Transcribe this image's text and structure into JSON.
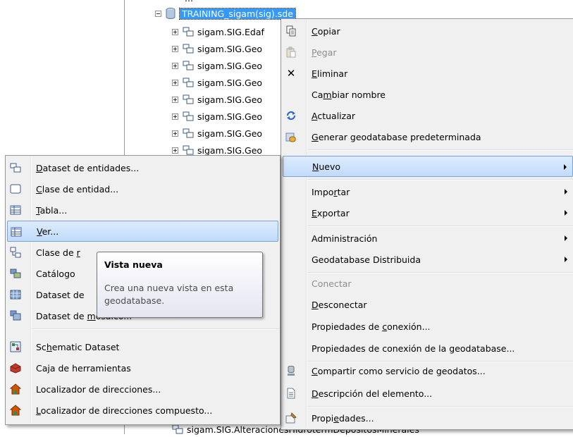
{
  "tree": {
    "top_partial": "...",
    "connection_label": "TRAINING_sigam(sig).sde",
    "items": [
      {
        "label": "sigam.SIG.Edaf"
      },
      {
        "label": "sigam.SIG.Geo"
      },
      {
        "label": "sigam.SIG.Geo"
      },
      {
        "label": "sigam.SIG.Geo"
      },
      {
        "label": "sigam.SIG.Geo"
      },
      {
        "label": "sigam.SIG.Geo"
      },
      {
        "label": "sigam.SIG.Geo"
      },
      {
        "label": "sigam.SIG.Geo"
      }
    ],
    "bottom_item": "sigam.SIG.AlteracionesHidrotermDepositosMinerales"
  },
  "context_menu": {
    "copiar": {
      "pre": "",
      "key": "C",
      "post": "opiar",
      "icon": "copy-icon"
    },
    "pegar": {
      "pre": "",
      "key": "P",
      "post": "egar",
      "icon": "paste-icon"
    },
    "eliminar": {
      "pre": "",
      "key": "E",
      "post": "liminar",
      "icon": "delete-icon"
    },
    "cambiar_nombre": {
      "pre": "Ca",
      "key": "m",
      "post": "biar nombre"
    },
    "actualizar": {
      "pre": "",
      "key": "A",
      "post": "ctualizar",
      "icon": "refresh-icon"
    },
    "generar": {
      "pre": "",
      "key": "G",
      "post": "enerar geodatabase predeterminada",
      "icon": "default-geodatabase-icon"
    },
    "nuevo": {
      "pre": "",
      "key": "N",
      "post": "uevo"
    },
    "importar": {
      "pre": "Impo",
      "key": "r",
      "post": "tar"
    },
    "exportar": {
      "pre": "",
      "key": "E",
      "post": "xportar"
    },
    "administracion": {
      "label": "Administración"
    },
    "geodatabase_distribuida": {
      "label": "Geodatabase Distribuida"
    },
    "conectar": {
      "label": "Conectar"
    },
    "desconectar": {
      "pre": "",
      "key": "D",
      "post": "esconectar"
    },
    "prop_conexion": {
      "pre": "Propiedades de ",
      "key": "c",
      "post": "onexión..."
    },
    "prop_conexion_gdb": {
      "label": "Propiedades de conexión de la geodatabase..."
    },
    "compartir": {
      "pre": "",
      "key": "C",
      "post": "ompartir como servicio de geodatos...",
      "icon": "share-service-icon"
    },
    "descripcion": {
      "pre": "",
      "key": "D",
      "post": "escripción del elemento...",
      "icon": "item-description-icon"
    },
    "propiedades": {
      "pre": "Propi",
      "key": "e",
      "post": "dades...",
      "icon": "properties-icon"
    }
  },
  "submenu": {
    "dataset_entidades": {
      "pre": "",
      "key": "D",
      "post": "ataset de entidades...",
      "icon": "feature-dataset-icon"
    },
    "clase_entidad": {
      "pre": "",
      "key": "C",
      "post": "lase de entidad...",
      "icon": "feature-class-icon"
    },
    "tabla": {
      "pre": "",
      "key": "T",
      "post": "abla...",
      "icon": "table-icon"
    },
    "ver": {
      "pre": "",
      "key": "V",
      "post": "er...",
      "icon": "view-icon"
    },
    "clase_relacion": {
      "pre": "Clase de ",
      "key": "r",
      "post": "",
      "icon": "relationship-class-icon"
    },
    "catalogo": {
      "label": "Catálogo",
      "icon": "raster-catalog-icon"
    },
    "dataset_raster": {
      "label": "Dataset de",
      "icon": "raster-dataset-icon"
    },
    "dataset_mosaico": {
      "pre": "Dataset de ",
      "key": "m",
      "post": "osaico...",
      "icon": "mosaic-dataset-icon"
    },
    "schematic": {
      "pre": "Sc",
      "key": "h",
      "post": "ematic Dataset",
      "icon": "schematic-dataset-icon"
    },
    "caja": {
      "label": "Caja de herramientas",
      "icon": "toolbox-icon"
    },
    "localizador": {
      "label": "Localizador de direcciones...",
      "icon": "address-locator-icon"
    },
    "localizador_compuesto": {
      "pre": "",
      "key": "L",
      "post": "ocalizador de direcciones compuesto...",
      "icon": "composite-locator-icon"
    }
  },
  "tooltip": {
    "title": "Vista nueva",
    "body": "Crea una nueva vista en esta geodatabase."
  }
}
